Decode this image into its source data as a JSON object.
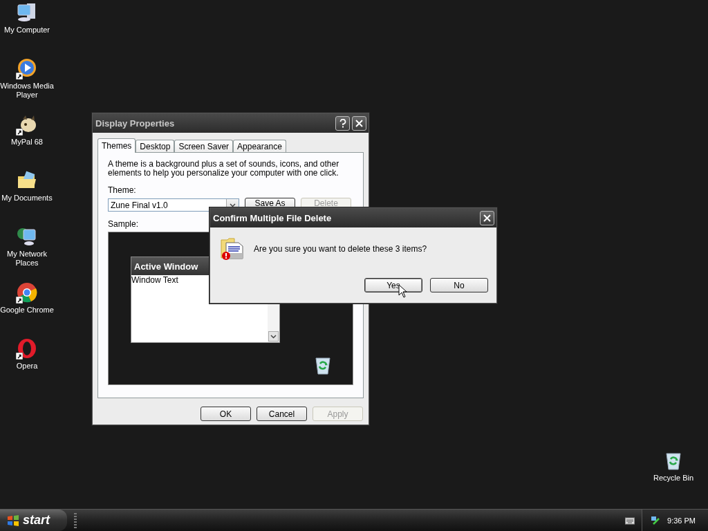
{
  "desktop_icons": [
    {
      "label": "My Computer",
      "kind": "computer",
      "shortcut": false
    },
    {
      "label": "Windows Media Player",
      "kind": "media",
      "shortcut": true
    },
    {
      "label": "MyPal 68",
      "kind": "pal",
      "shortcut": true
    },
    {
      "label": "My Documents",
      "kind": "documents",
      "shortcut": false
    },
    {
      "label": "My Network Places",
      "kind": "network",
      "shortcut": false
    },
    {
      "label": "Google Chrome",
      "kind": "chrome",
      "shortcut": true
    },
    {
      "label": "Opera",
      "kind": "opera",
      "shortcut": true
    }
  ],
  "recycle_bin": {
    "label": "Recycle Bin",
    "kind": "recycle",
    "shortcut": false
  },
  "display_properties": {
    "title": "Display Properties",
    "tabs": [
      {
        "label": "Themes",
        "selected": true
      },
      {
        "label": "Desktop",
        "selected": false
      },
      {
        "label": "Screen Saver",
        "selected": false
      },
      {
        "label": "Appearance",
        "selected": false
      }
    ],
    "description": "A theme is a background plus a set of sounds, icons, and other elements to help you personalize your computer with one click.",
    "theme_label": "Theme:",
    "theme_value": "Zune Final v1.0",
    "theme_buttons": [
      {
        "label": "Save As",
        "disabled": false
      },
      {
        "label": "Delete",
        "disabled": true
      }
    ],
    "sample_label": "Sample:",
    "sample_window": {
      "title": "Active Window",
      "text": "Window Text"
    },
    "buttons": [
      {
        "label": "OK",
        "disabled": false
      },
      {
        "label": "Cancel",
        "disabled": false
      },
      {
        "label": "Apply",
        "disabled": true
      }
    ]
  },
  "confirm_dialog": {
    "title": "Confirm Multiple File Delete",
    "message": "Are you sure you want to delete these 3 items?",
    "buttons": [
      {
        "label": "Yes",
        "selected": true
      },
      {
        "label": "No",
        "selected": false
      }
    ]
  },
  "taskbar": {
    "start": "start",
    "clock": "9:36 PM"
  }
}
